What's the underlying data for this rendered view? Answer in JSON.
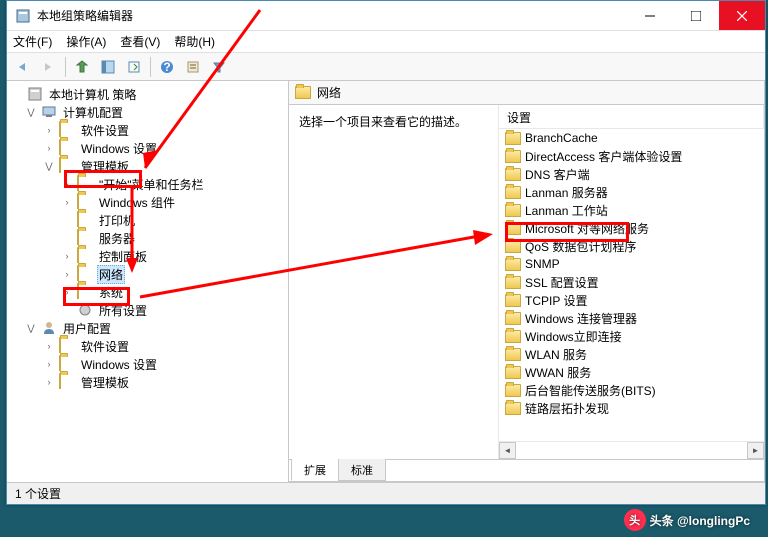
{
  "window": {
    "title": "本地组策略编辑器"
  },
  "menu": {
    "file": "文件(F)",
    "action": "操作(A)",
    "view": "查看(V)",
    "help": "帮助(H)"
  },
  "tree": {
    "root": "本地计算机 策略",
    "computer": "计算机配置",
    "software": "软件设置",
    "windows_settings": "Windows 设置",
    "admin_templates": "管理模板",
    "start_taskbar": "\"开始\"菜单和任务栏",
    "win_components": "Windows 组件",
    "printer": "打印机",
    "server": "服务器",
    "control_panel": "控制面板",
    "network": "网络",
    "system": "系统",
    "all_settings": "所有设置",
    "user": "用户配置",
    "u_software": "软件设置",
    "u_windows": "Windows 设置",
    "u_admin": "管理模板"
  },
  "right": {
    "header": "网络",
    "desc": "选择一个项目来查看它的描述。",
    "col_setting": "设置",
    "items": [
      "BranchCache",
      "DirectAccess 客户端体验设置",
      "DNS 客户端",
      "Lanman 服务器",
      "Lanman 工作站",
      "Microsoft 对等网络服务",
      "QoS 数据包计划程序",
      "SNMP",
      "SSL 配置设置",
      "TCPIP 设置",
      "Windows 连接管理器",
      "Windows立即连接",
      "WLAN 服务",
      "WWAN 服务",
      "后台智能传送服务(BITS)",
      "链路层拓扑发现"
    ],
    "tabs": {
      "ext": "扩展",
      "std": "标准"
    }
  },
  "status": "1 个设置",
  "watermark": "头条 @longlingPc"
}
